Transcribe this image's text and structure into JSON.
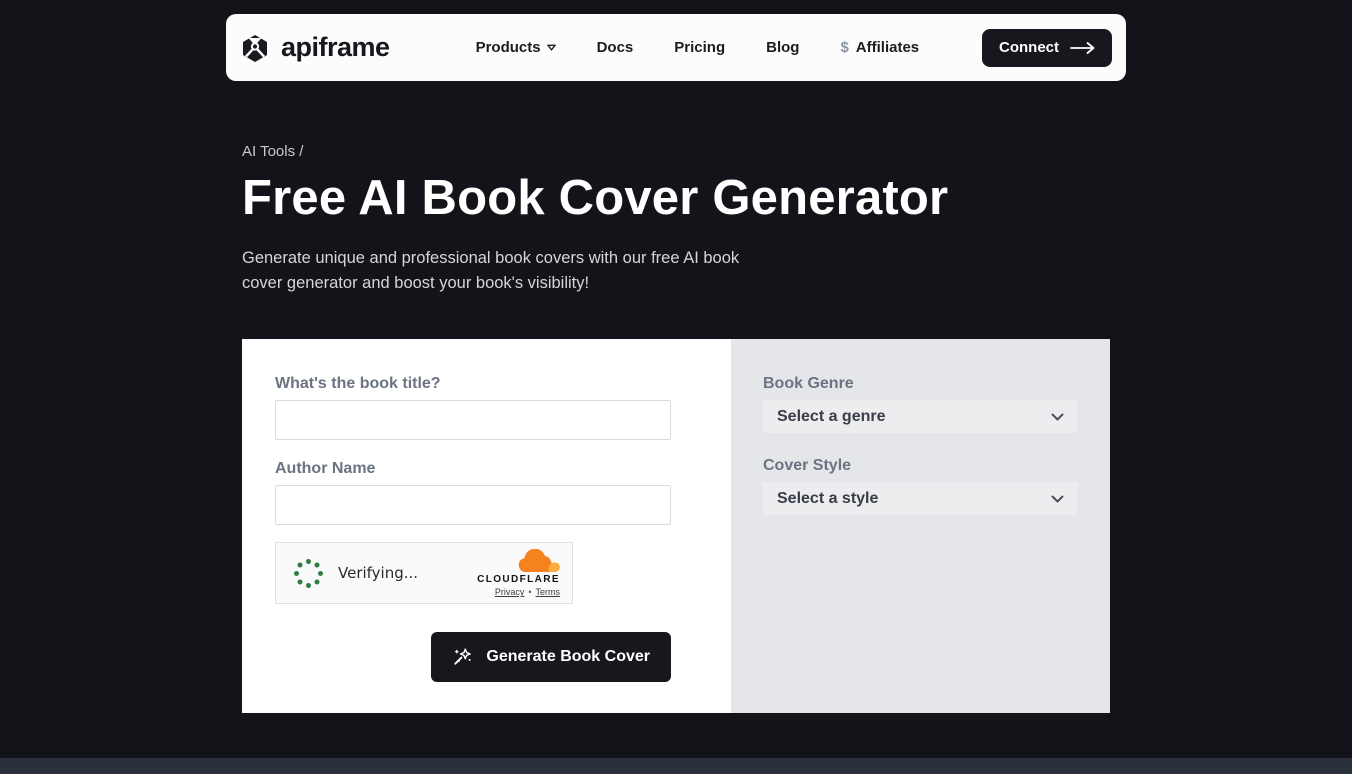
{
  "navbar": {
    "brand": "apiframe",
    "items": [
      {
        "label": "Products"
      },
      {
        "label": "Docs"
      },
      {
        "label": "Pricing"
      },
      {
        "label": "Blog"
      },
      {
        "label": "Affiliates",
        "prefix": "$"
      }
    ],
    "connect": {
      "label": "Connect"
    }
  },
  "hero": {
    "breadcrumb": "AI Tools /",
    "title": "Free AI Book Cover Generator",
    "subtitle": "Generate unique and professional book covers with our free AI book cover generator and boost your book's visibility!"
  },
  "form": {
    "book_title": {
      "label": "What's the book title?",
      "value": ""
    },
    "author_name": {
      "label": "Author Name",
      "value": ""
    },
    "captcha": {
      "status": "Verifying...",
      "brand": "CLOUDFLARE",
      "privacy_link": "Privacy",
      "separator": "•",
      "terms_link": "Terms"
    },
    "submit": {
      "label": "Generate Book Cover"
    }
  },
  "options": {
    "genre": {
      "label": "Book Genre",
      "selected": "Select a genre"
    },
    "style": {
      "label": "Cover Style",
      "selected": "Select a style"
    }
  },
  "colors": {
    "page_background": "#131419",
    "accent_dark": "#17181d",
    "panel_gray": "#e5e6e9",
    "cloudflare_orange": "#f6821f",
    "cloudflare_orange_light": "#fbad41",
    "spinner_green": "#2c7d3f",
    "footer_strip": "#2b303d"
  }
}
